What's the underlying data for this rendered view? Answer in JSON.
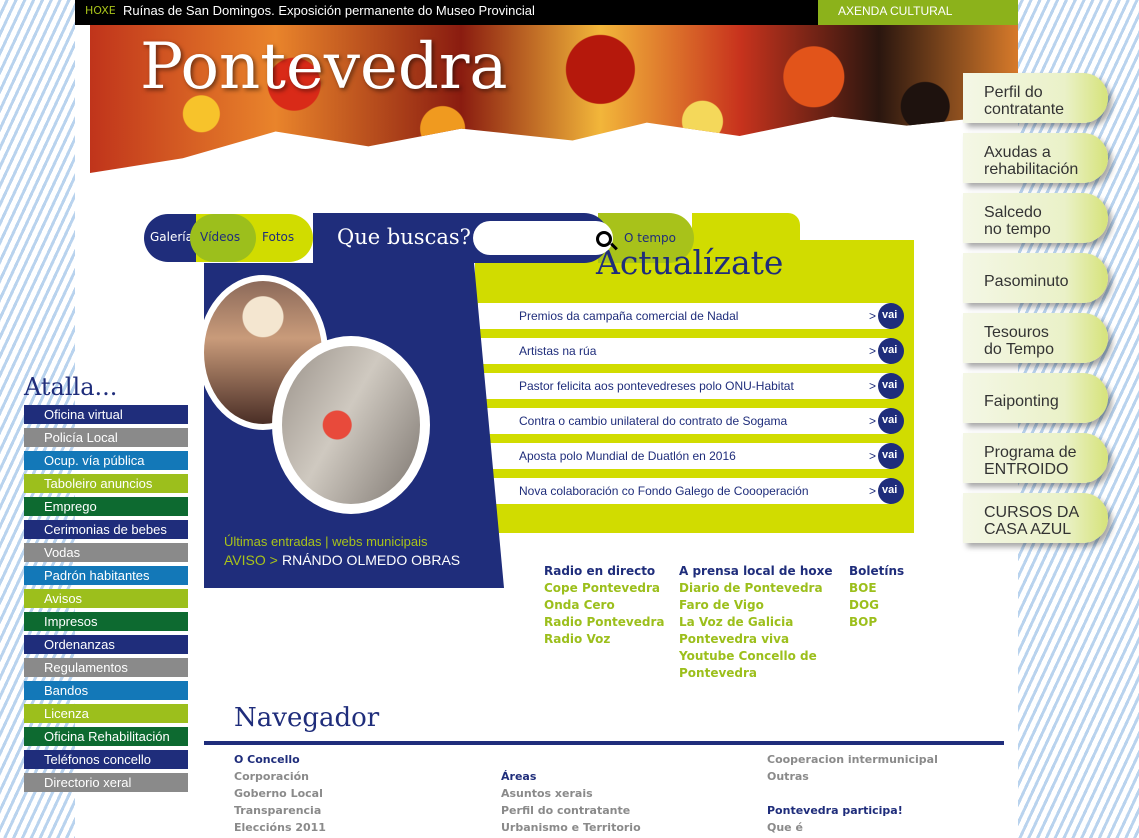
{
  "topbar": {
    "hoxe_label": "HOXE",
    "headline": "Ruínas de San Domingos. Exposición permanente do Museo Provincial",
    "agenda_label": "AXENDA CULTURAL"
  },
  "banner": {
    "brand": "Pontevedra"
  },
  "right_tabs": [
    {
      "line1": "Perfil do",
      "line2": "contratante"
    },
    {
      "line1": "Axudas a",
      "line2": "rehabilitación"
    },
    {
      "line1": "Salcedo",
      "line2": "no tempo"
    },
    {
      "line1": "Pasominuto",
      "line2": ""
    },
    {
      "line1": "Tesouros",
      "line2": "do Tempo"
    },
    {
      "line1": "Faiponting",
      "line2": ""
    },
    {
      "line1": "Programa de",
      "line2": "ENTROIDO"
    },
    {
      "line1": "CURSOS DA",
      "line2": "CASA AZUL"
    }
  ],
  "media_tabs": {
    "gallery": "Galería",
    "videos": "Vídeos",
    "photos": "Fotos"
  },
  "search": {
    "label": "Que buscas?",
    "value": ""
  },
  "weather_tab": "O tempo",
  "news_panel": {
    "title": "Actualízate",
    "go_arrow": ">",
    "go_label": "vai",
    "items": [
      "Premios da campaña comercial de Nadal",
      "Artistas na rúa",
      "Pastor felicita aos pontevedreses polo ONU-Habitat",
      "Contra o cambio unilateral do contrato de Sogama",
      "Aposta polo Mundial de Duatlón en 2016",
      "Nova colaboración co Fondo Galego de Coooperación"
    ]
  },
  "feature": {
    "links": "Últimas entradas | webs municipais",
    "aviso_label": "AVISO >",
    "ticker": "RNÁNDO OLMEDO       OBRAS"
  },
  "media_cols": {
    "radio": {
      "title": "Radio en directo",
      "items": [
        "Cope Pontevedra",
        "Onda Cero",
        "Radio Pontevedra",
        "Radio Voz"
      ]
    },
    "press": {
      "title": "A prensa local de hoxe",
      "items": [
        "Diario de Pontevedra",
        "Faro de Vigo",
        "La Voz de Galicia",
        "Pontevedra viva",
        "Youtube Concello de",
        "Pontevedra"
      ]
    },
    "bulletins": {
      "title": "Boletíns",
      "items": [
        "BOE",
        "DOG",
        "BOP"
      ]
    }
  },
  "shortcuts": {
    "title": "Atalla...",
    "items": [
      {
        "label": "Oficina virtual",
        "color": "#1f2d7b"
      },
      {
        "label": "Policía Local",
        "color": "#8a8a8a"
      },
      {
        "label": "Ocup. vía pública",
        "color": "#1378b8"
      },
      {
        "label": "Taboleiro anuncios",
        "color": "#9cbf1c"
      },
      {
        "label": "Emprego",
        "color": "#0d6a30"
      },
      {
        "label": "Cerimonias de bebes",
        "color": "#1f2d7b"
      },
      {
        "label": "Vodas",
        "color": "#8a8a8a"
      },
      {
        "label": "Padrón habitantes",
        "color": "#1378b8"
      },
      {
        "label": "Avisos",
        "color": "#9cbf1c"
      },
      {
        "label": "Impresos",
        "color": "#0d6a30"
      },
      {
        "label": "Ordenanzas",
        "color": "#1f2d7b"
      },
      {
        "label": "Regulamentos",
        "color": "#8a8a8a"
      },
      {
        "label": "Bandos",
        "color": "#1378b8"
      },
      {
        "label": "Licenza",
        "color": "#9cbf1c"
      },
      {
        "label": "Oficina Rehabilitación",
        "color": "#0d6a30"
      },
      {
        "label": "Teléfonos concello",
        "color": "#1f2d7b"
      },
      {
        "label": "Directorio xeral",
        "color": "#8a8a8a"
      }
    ]
  },
  "navigator": {
    "title": "Navegador",
    "col1": {
      "heading": "O Concello",
      "items": [
        "Corporación",
        "Goberno Local",
        "Transparencia",
        "Eleccións 2011"
      ]
    },
    "col2": {
      "heading": "Áreas",
      "items": [
        "Asuntos xerais",
        "Perfil do contratante",
        "Urbanismo e Territorio"
      ]
    },
    "col3": {
      "items": [
        "Cooperacion intermunicipal",
        "Outras"
      ],
      "heading2": "Pontevedra participa!",
      "items2": [
        "Que é"
      ]
    }
  },
  "colors": {
    "navy": "#1f2d7b",
    "lime": "#d1dc00",
    "green": "#9cbf1c"
  }
}
